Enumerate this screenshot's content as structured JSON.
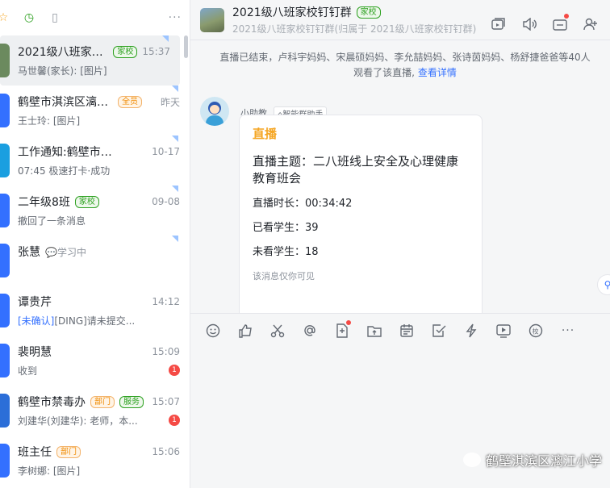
{
  "sidebar": {
    "conversations": [
      {
        "name": "2021级八班家校...",
        "tag": "家校",
        "tag_color": "green",
        "time": "15:37",
        "message": "马世馨(家长): [图片]",
        "active": true,
        "avatar_color": "#6b8a5e",
        "corner": true
      },
      {
        "name": "鹤壁市淇滨区漓江...",
        "tag": "全员",
        "tag_color": "orange",
        "time": "昨天",
        "message": "王士玲: [图片]",
        "avatar_color": "#3370ff",
        "corner": true
      },
      {
        "name": "工作通知:鹤壁市淇滨区...",
        "time": "10-17",
        "message": "07:45 极速打卡·成功",
        "avatar_color": "#1a9fe0",
        "corner": true
      },
      {
        "name": "二年级8班",
        "tag": "家校",
        "tag_color": "green",
        "time": "09-08",
        "message": "撤回了一条消息",
        "avatar_color": "#3370ff",
        "corner": true
      },
      {
        "name": "张慧",
        "status": "💬学习中",
        "time": "",
        "message": "",
        "avatar_color": "#3370ff",
        "corner": true
      },
      {
        "name": "谭贵芹",
        "time": "14:12",
        "message_prefix": "[未确认]",
        "message": "[DING]请未提交...",
        "avatar_color": "#3370ff"
      },
      {
        "name": "裴明慧",
        "time": "15:09",
        "message": "收到",
        "badge": "1",
        "avatar_color": "#3370ff"
      },
      {
        "name": "鹤壁市禁毒办",
        "tag": "部门",
        "tag_color": "orange",
        "tag2": "服务",
        "tag2_color": "green",
        "time": "15:07",
        "message": "刘建华(刘建华): 老师，本...",
        "badge": "1",
        "avatar_color": "#2b6ed8"
      },
      {
        "name": "班主任",
        "tag": "部门",
        "tag_color": "orange",
        "time": "15:06",
        "message": "李树娜: [图片]",
        "avatar_color": "#3370ff"
      }
    ]
  },
  "header": {
    "title": "2021级八班家校钉钉群",
    "tag": "家校",
    "subtitle": "2021级八班家校钉钉群(归属于 2021级八班家校钉钉群)"
  },
  "system_message": {
    "text": "直播已结束，卢科宇妈妈、宋晨硕妈妈、李允喆妈妈、张诗茵妈妈、杨舒捷爸爸等40人观看了该直播,",
    "link": "查看详情"
  },
  "message": {
    "sender": "小助教",
    "sender_tag": "智能群助手",
    "card": {
      "title": "直播",
      "topic": "直播主题：二八班线上安全及心理健康教育班会",
      "duration": "直播时长：00:34:42",
      "watched": "已看学生：39",
      "unwatched": "未看学生：18",
      "note": "该消息仅你可见"
    }
  },
  "watermark": "鹤壁淇滨区漓江小学",
  "colors": {
    "accent": "#3370ff",
    "card_title": "#f5a623",
    "badge": "#f54a45"
  }
}
